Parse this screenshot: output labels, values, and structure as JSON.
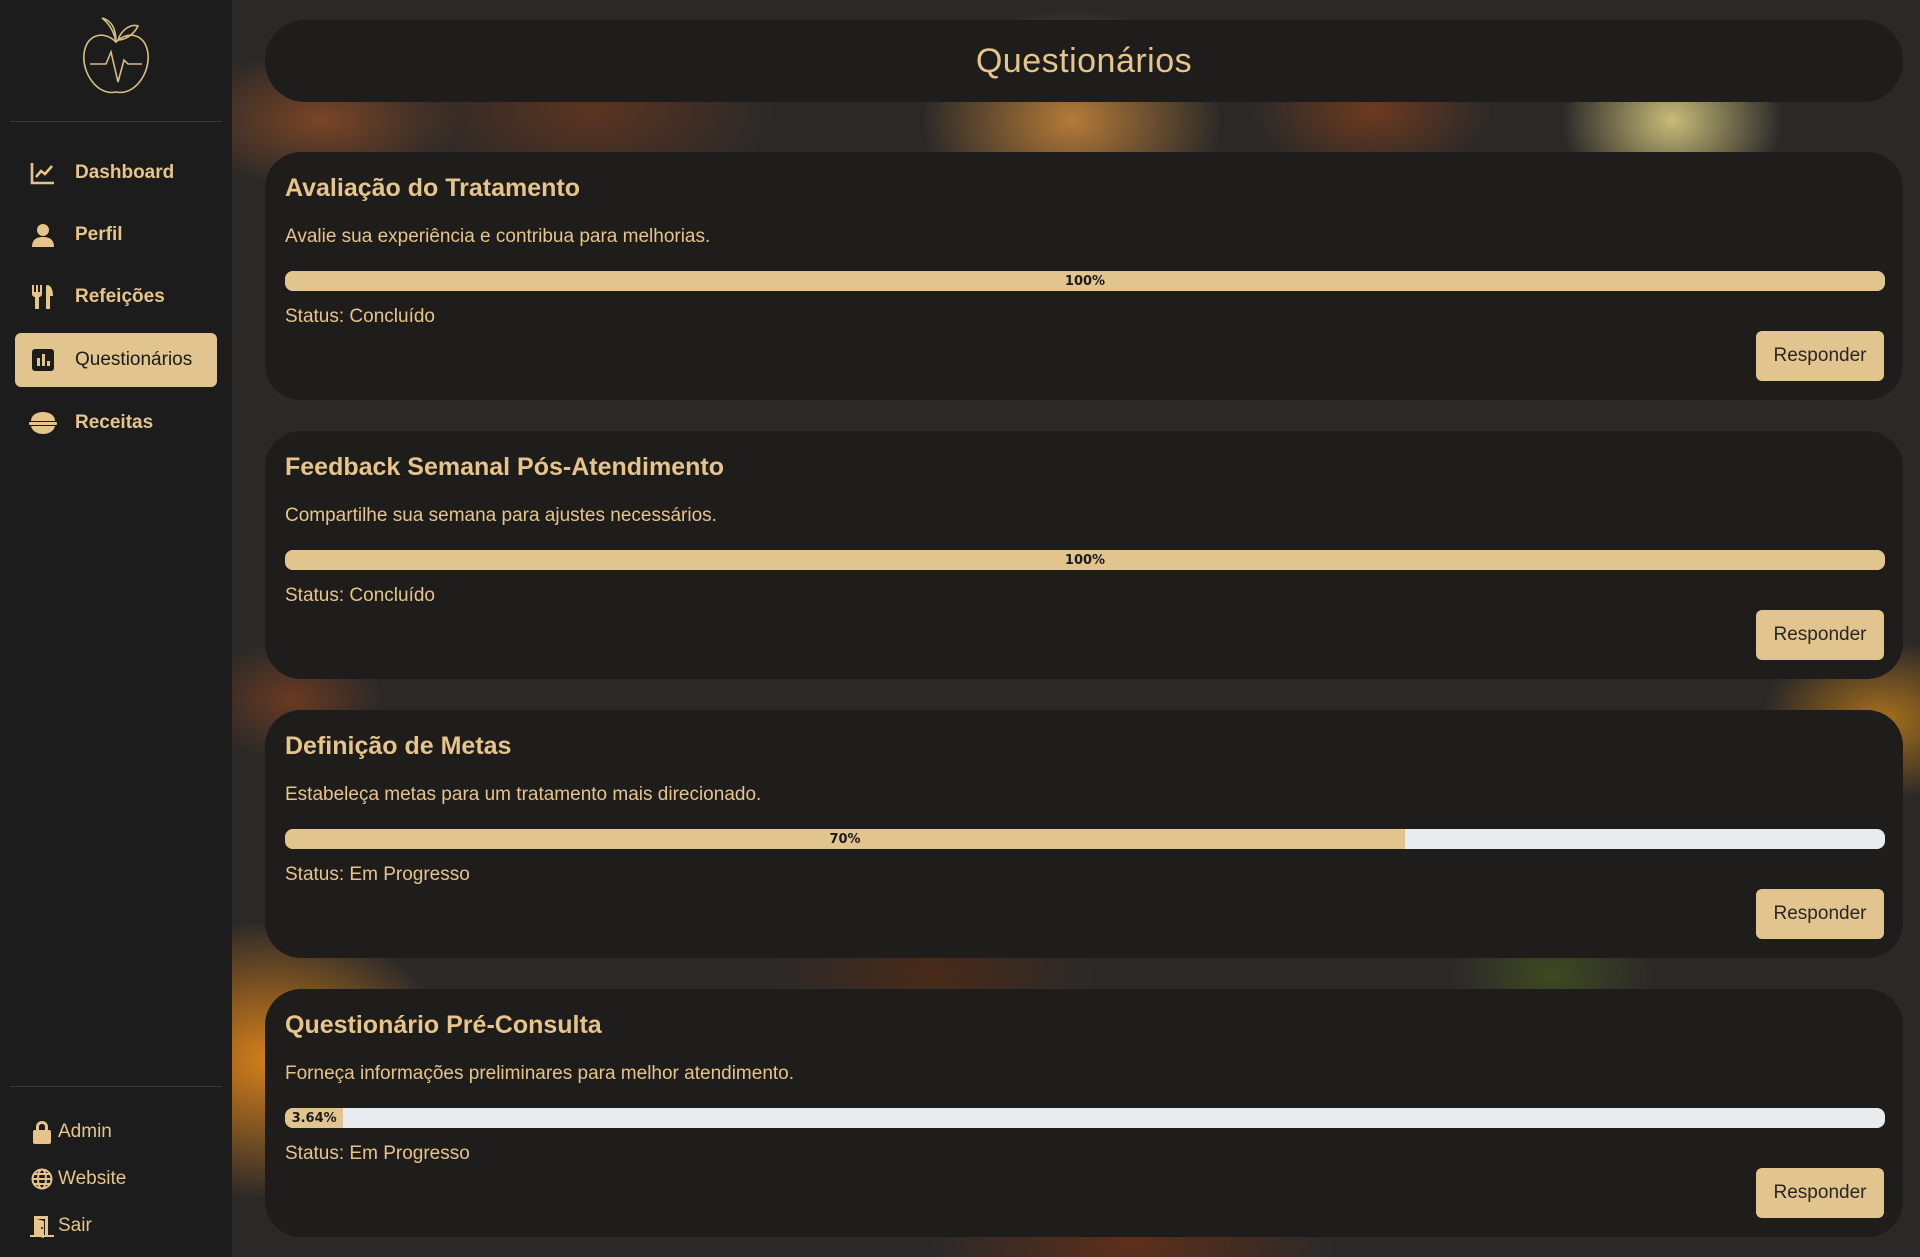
{
  "sidebar": {
    "nav": [
      {
        "label": "Dashboard",
        "icon": "chart-line-icon",
        "active": false
      },
      {
        "label": "Perfil",
        "icon": "user-icon",
        "active": false
      },
      {
        "label": "Refeições",
        "icon": "utensils-icon",
        "active": false
      },
      {
        "label": "Questionários",
        "icon": "bar-chart-icon",
        "active": true
      },
      {
        "label": "Receitas",
        "icon": "bowl-icon",
        "active": false
      }
    ],
    "footer": [
      {
        "label": "Admin",
        "icon": "lock-icon"
      },
      {
        "label": "Website",
        "icon": "globe-icon"
      },
      {
        "label": "Sair",
        "icon": "door-exit-icon"
      }
    ]
  },
  "header": {
    "title": "Questionários"
  },
  "questionnaires": [
    {
      "title": "Avaliação do Tratamento",
      "description": "Avalie sua experiência e contribua para melhorias.",
      "progress": 100,
      "progress_label": "100%",
      "status": "Status: Concluído",
      "button": "Responder"
    },
    {
      "title": "Feedback Semanal Pós-Atendimento",
      "description": "Compartilhe sua semana para ajustes necessários.",
      "progress": 100,
      "progress_label": "100%",
      "status": "Status: Concluído",
      "button": "Responder"
    },
    {
      "title": "Definição de Metas",
      "description": "Estabeleça metas para um tratamento mais direcionado.",
      "progress": 70,
      "progress_label": "70%",
      "status": "Status: Em Progresso",
      "button": "Responder"
    },
    {
      "title": "Questionário Pré-Consulta",
      "description": "Forneça informações preliminares para melhor atendimento.",
      "progress": 3.64,
      "progress_label": "3.64%",
      "status": "Status: Em Progresso",
      "button": "Responder"
    }
  ],
  "colors": {
    "accent": "#e2c48f",
    "sidebar": "#1c1c1c",
    "card": "#1e1d1c",
    "text": "#e6c48a",
    "track": "#e9ecef"
  }
}
